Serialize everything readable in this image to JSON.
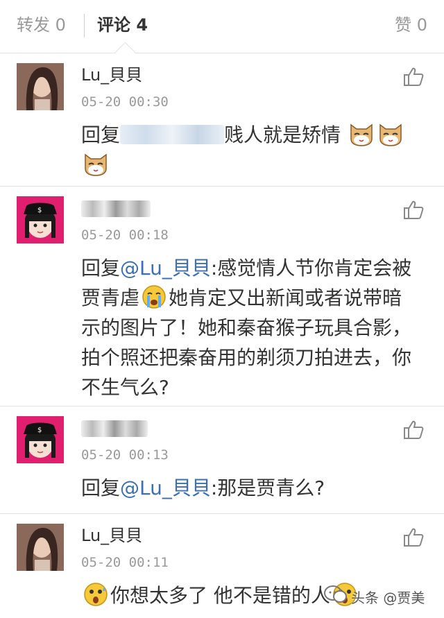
{
  "tabs": {
    "repost": "转发 0",
    "comment": "评论 4",
    "like": "赞 0"
  },
  "comments": [
    {
      "name": "Lu_貝貝",
      "time": "05-20 00:30",
      "prefix": "回复",
      "text": "贱人就是矫情"
    },
    {
      "time": "05-20 00:18",
      "prefix": "回复",
      "mention": "@Lu_貝貝",
      "text_a": ":感觉情人节你肯定会被贾青虐",
      "text_b": "她肯定又出新闻或者说带暗示的图片了！她和秦奋猴子玩具合影，拍个照还把秦奋用的剃须刀拍进去，你不生气么?"
    },
    {
      "time": "05-20 00:13",
      "prefix": "回复",
      "mention": "@Lu_貝貝",
      "text": ":那是贾青么?"
    },
    {
      "name": "Lu_貝貝",
      "time": "05-20 00:11",
      "text_a": "你想太多了 他不是错的人"
    }
  ],
  "watermark": "头条 @贾美",
  "icons": [
    "thumbs-up-icon",
    "cat-face-icon",
    "crying-face-icon",
    "shocked-face-icon"
  ],
  "colors": {
    "mention": "#3b6fb6",
    "text": "#333333",
    "meta": "#999999"
  }
}
